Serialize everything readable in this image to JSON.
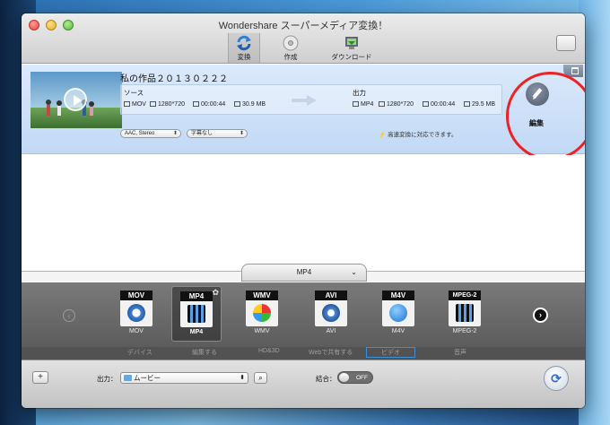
{
  "window": {
    "title": "Wondershare スーパーメディア変換！"
  },
  "toolbar": {
    "items": [
      {
        "label": "変換",
        "icon": "convert-icon"
      },
      {
        "label": "作成",
        "icon": "disc-icon"
      },
      {
        "label": "ダウンロード",
        "icon": "download-icon"
      }
    ],
    "right_icon": "notes-icon"
  },
  "file": {
    "name": "私の作品２０１３０２２２",
    "source_label": "ソース",
    "source": {
      "format": "MOV",
      "resolution": "1280*720",
      "duration": "00:00:44",
      "size": "30.9 MB"
    },
    "output_label": "出力",
    "output": {
      "format": "MP4",
      "resolution": "1280*720",
      "duration": "00:00:44",
      "size": "29.5 MB"
    },
    "audio": "AAC, Stereo",
    "subtitle": "字幕なし",
    "hint": "高速変換に対応できます。",
    "edit_label": "編集"
  },
  "format_bar": {
    "current": "MP4"
  },
  "formats": [
    {
      "cap": "MOV",
      "name": "MOV"
    },
    {
      "cap": "MP4",
      "name": "MP4"
    },
    {
      "cap": "WMV",
      "name": "WMV"
    },
    {
      "cap": "AVI",
      "name": "AVI"
    },
    {
      "cap": "M4V",
      "name": "M4V"
    },
    {
      "cap": "MPEG-2",
      "name": "MPEG-2"
    }
  ],
  "categories": [
    "デバイス",
    "編集する",
    "HD&3D",
    "Webで共有する",
    "ビデオ",
    "音声"
  ],
  "bottom": {
    "output_label": "出力：",
    "output_folder": "ムービー",
    "merge_label": "結合：",
    "merge_state": "OFF"
  }
}
